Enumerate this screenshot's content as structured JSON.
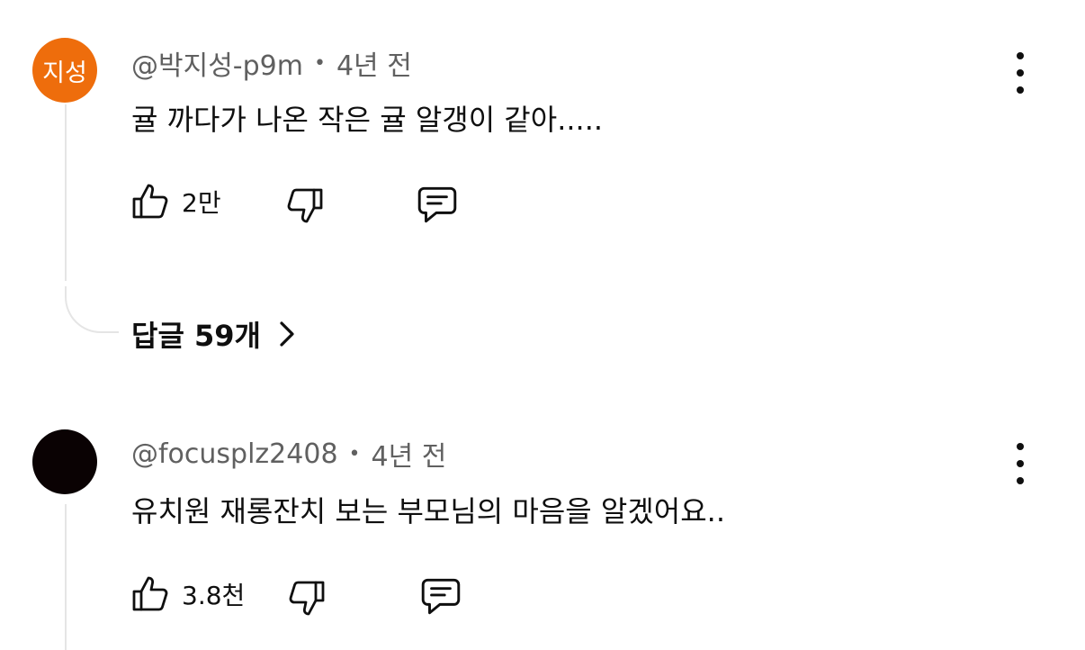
{
  "comments": [
    {
      "avatar_text": "지성",
      "avatar_color": "#ee6d0c",
      "author": "@박지성-p9m",
      "time": "4년 전",
      "text": "귤 까다가 나온 작은 귤 알갱이 같아.....",
      "likes": "2만",
      "replies_label": "답글 59개"
    },
    {
      "avatar_text": "",
      "avatar_color": "#0a0203",
      "author": "@focusplz2408",
      "time": "4년 전",
      "text": "유치원 재롱잔치 보는 부모님의 마음을 알겠어요..",
      "likes": "3.8천"
    }
  ],
  "separator": "•",
  "icons": {
    "like": "thumbs-up-icon",
    "dislike": "thumbs-down-icon",
    "reply": "comment-icon",
    "more": "more-vert-icon",
    "chevron": "chevron-right-icon"
  }
}
